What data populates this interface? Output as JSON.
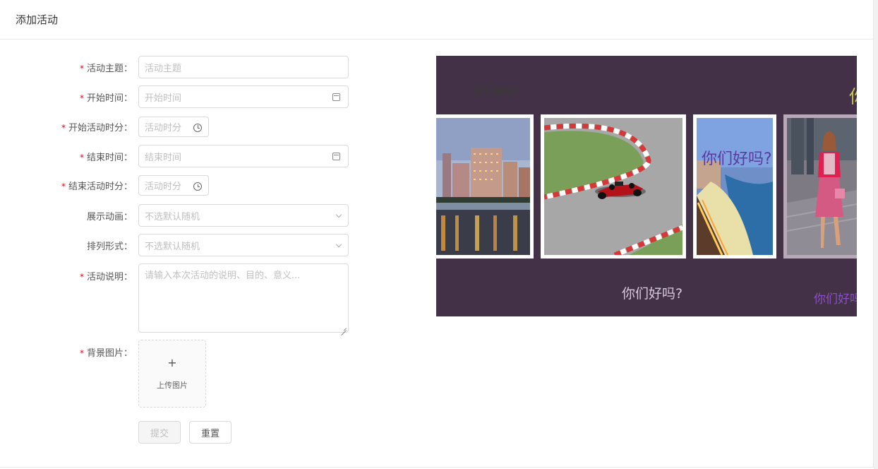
{
  "header": {
    "title": "添加活动"
  },
  "form": {
    "subject": {
      "label": "活动主题：",
      "placeholder": "活动主题",
      "required": true
    },
    "start_date": {
      "label": "开始时间：",
      "placeholder": "开始时间",
      "required": true
    },
    "start_time": {
      "label": "开始活动时分：",
      "placeholder": "活动时分",
      "required": true
    },
    "end_date": {
      "label": "结束时间：",
      "placeholder": "结束时间",
      "required": true
    },
    "end_time": {
      "label": "结束活动时分：",
      "placeholder": "活动时分",
      "required": true
    },
    "animation": {
      "label": "展示动画：",
      "placeholder": "不选默认随机",
      "required": false
    },
    "layout": {
      "label": "排列形式：",
      "placeholder": "不选默认随机",
      "required": false
    },
    "description": {
      "label": "活动说明：",
      "placeholder": "请输入本次活动的说明、目的、意义...",
      "required": true
    },
    "background": {
      "label": "背景图片：",
      "upload_label": "上传图片",
      "upload_icon": "+",
      "required": true
    },
    "required_mark": "*",
    "submit_label": "提交",
    "reset_label": "重置"
  },
  "preview": {
    "background_color": "#433247",
    "floating_texts": [
      {
        "text": "你们好吗?",
        "color": "#3a3a30"
      },
      {
        "text": "你",
        "color": "#c7c45a"
      },
      {
        "text": "你们好吗?",
        "color": "#5a3aa0"
      },
      {
        "text": "你们好吗?",
        "color": "#d7c9e0"
      },
      {
        "text": "你们好吗",
        "color": "#8b4fc0"
      }
    ],
    "photos": [
      "city-night-photo",
      "race-car-photo",
      "beach-city-photo",
      "fashion-woman-photo"
    ]
  }
}
